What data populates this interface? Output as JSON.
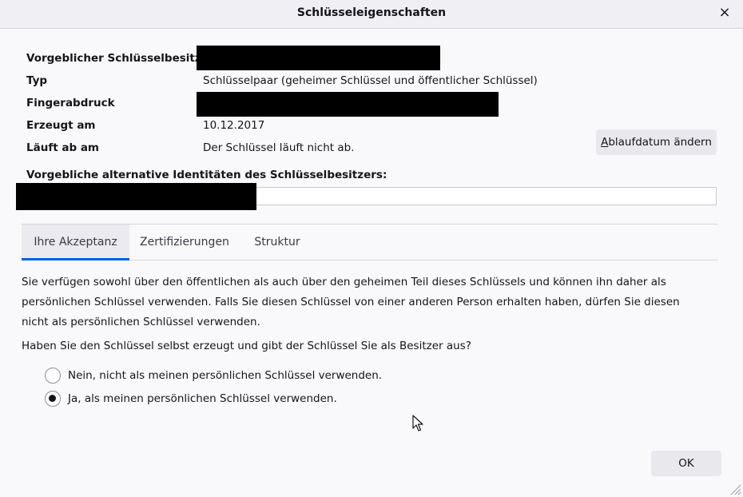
{
  "window": {
    "title": "Schlüsseleigenschaften",
    "close_glyph": "×"
  },
  "properties": [
    {
      "label": "Vorgeblicher Schlüsselbesitzer",
      "value": ""
    },
    {
      "label": "Typ",
      "value": "Schlüsselpaar (geheimer Schlüssel und öffentlicher Schlüssel)"
    },
    {
      "label": "Fingerabdruck",
      "value": ""
    },
    {
      "label": "Erzeugt am",
      "value": "10.12.2017"
    },
    {
      "label": "Läuft ab am",
      "value": "Der Schlüssel läuft nicht ab."
    }
  ],
  "expiry_button": {
    "accesskey": "A",
    "label_rest": "blaufdatum ändern"
  },
  "alt_identities": {
    "label": "Vorgebliche alternative Identitäten des Schlüsselbesitzers:",
    "value": ""
  },
  "tabs": [
    {
      "label": "Ihre Akzeptanz",
      "active": true
    },
    {
      "label": "Zertifizierungen",
      "active": false
    },
    {
      "label": "Struktur",
      "active": false
    }
  ],
  "acceptance": {
    "paragraph": "Sie verfügen sowohl über den öffentlichen als auch über den geheimen Teil dieses Schlüssels und können ihn daher als persönlichen Schlüssel verwenden. Falls Sie diesen Schlüssel von einer anderen Person erhalten haben, dürfen Sie diesen nicht als persönlichen Schlüssel verwenden.",
    "question": "Haben Sie den Schlüssel selbst erzeugt und gibt der Schlüssel Sie als Besitzer aus?",
    "options": [
      {
        "label": "Nein, nicht als meinen persönlichen Schlüssel verwenden.",
        "checked": false
      },
      {
        "label": "Ja, als meinen persönlichen Schlüssel verwenden.",
        "checked": true
      }
    ]
  },
  "ok_button": {
    "label": "OK"
  },
  "colors": {
    "accent": "#0061e0",
    "redaction": "#000000"
  },
  "icons": {
    "close": "close-icon",
    "cursor": "mouse-pointer-icon",
    "resize": "resize-grip-icon"
  }
}
